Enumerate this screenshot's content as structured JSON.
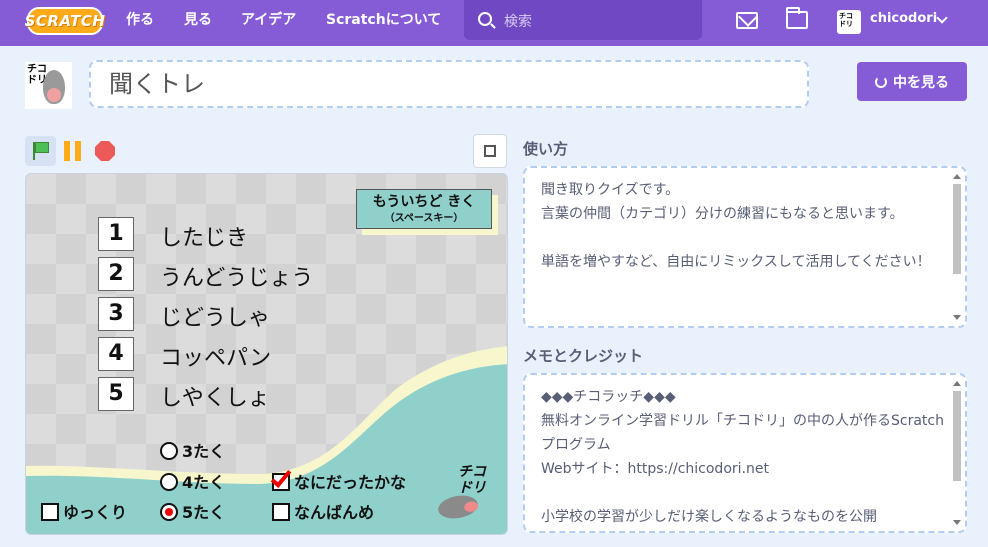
{
  "nav": {
    "logo": "SCRATCH",
    "links": [
      "作る",
      "見る",
      "アイデア",
      "Scratchについて"
    ],
    "search_placeholder": "検索",
    "username": "chicodori",
    "avatar_text": "チコ\nドリ"
  },
  "project": {
    "title": "聞くトレ",
    "see_inside": "中を見る",
    "owner_avatar_text": "チコ\nドリ"
  },
  "stage": {
    "replay_line1": "もういちど きく",
    "replay_line2": "（スペースキー）",
    "words": [
      {
        "num": "1",
        "text": "したじき"
      },
      {
        "num": "2",
        "text": "うんどうじょう"
      },
      {
        "num": "3",
        "text": "じどうしゃ"
      },
      {
        "num": "4",
        "text": "コッペパン"
      },
      {
        "num": "5",
        "text": "しやくしょ"
      }
    ],
    "options": {
      "q3": "3たく",
      "q4": "4たく",
      "q5": "5たく",
      "slow": "ゆっくり",
      "what_was_it": "なにだったかな",
      "hard": "なんばんめ"
    },
    "selected_option": "5たく",
    "checked": [
      "なにだったかな"
    ],
    "logo": "チコ\nドリ"
  },
  "instructions": {
    "heading": "使い方",
    "text": "聞き取りクイズです。\n言葉の仲間（カテゴリ）分けの練習にもなると思います。\n\n単語を増やすなど、自由にリミックスして活用してください！"
  },
  "notes": {
    "heading": "メモとクレジット",
    "text": "◆◆◆チコラッチ◆◆◆\n無料オンライン学習ドリル「チコドリ」の中の人が作るScratchプログラム\nWebサイト：https://chicodori.net\n\n小学校の学習が少しだけ楽しくなるようなものを公開"
  },
  "colors": {
    "nav": "#855cd6",
    "accent": "#855cd6",
    "stage_teal": "#8fd0cb",
    "stage_cream": "#f7f6cc",
    "panel_border": "#b3cdf2"
  }
}
